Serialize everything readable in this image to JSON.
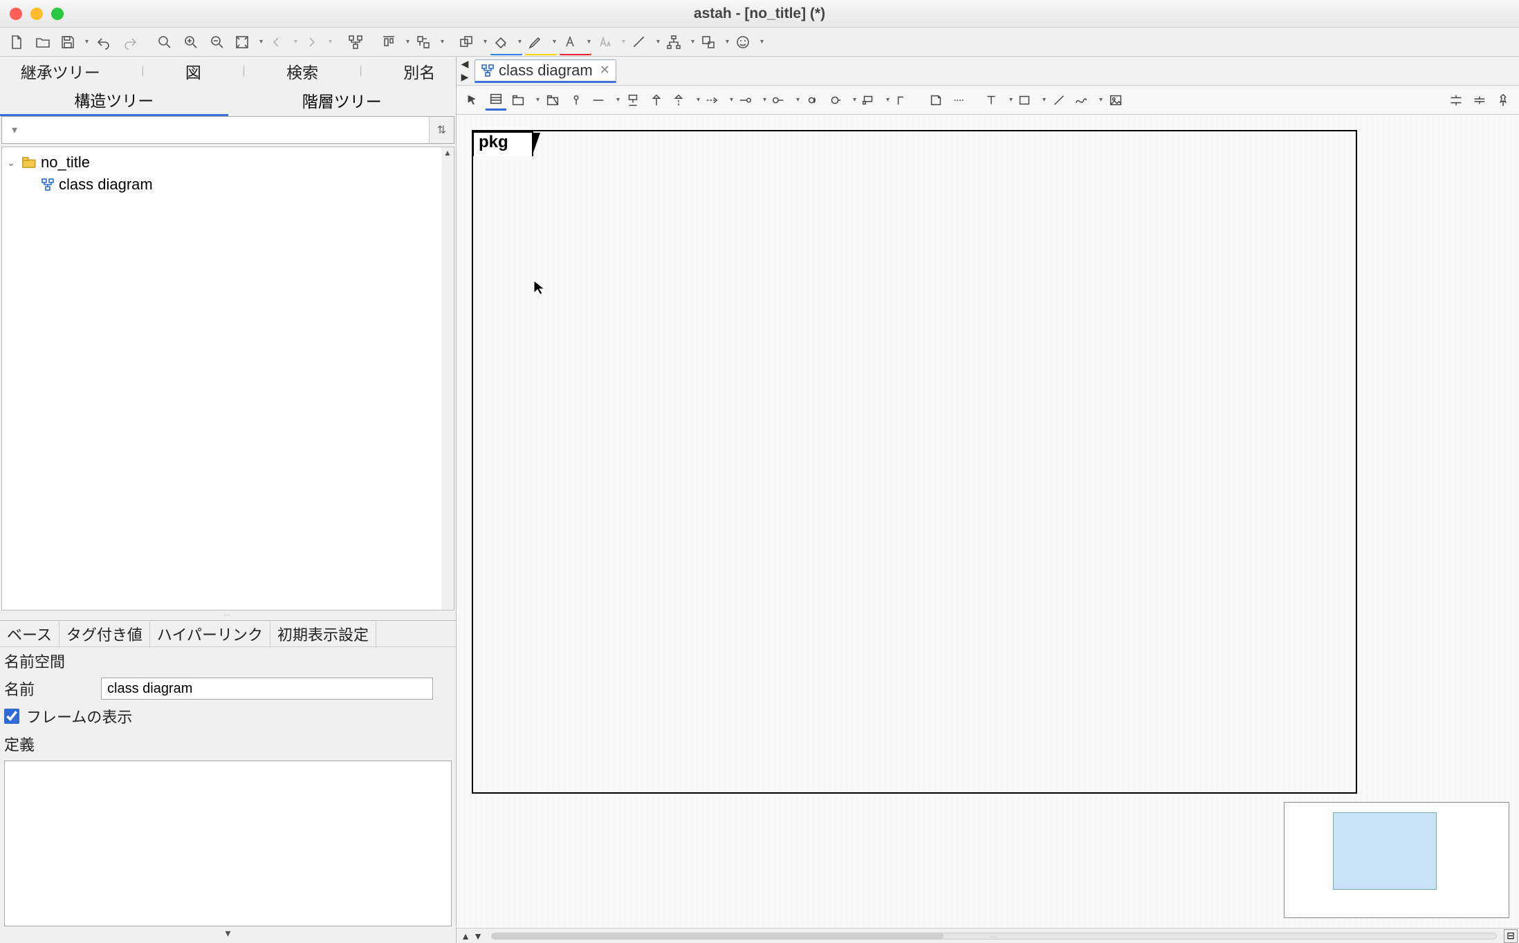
{
  "titlebar": {
    "title": "astah - [no_title] (*)"
  },
  "left": {
    "tabs_top": {
      "inherit": "継承ツリー",
      "diagram": "図",
      "search": "検索",
      "alias": "別名"
    },
    "tabs_bottom": {
      "structure": "構造ツリー",
      "hierarchy": "階層ツリー"
    },
    "filter_placeholder": "",
    "tree": {
      "root": "no_title",
      "items": [
        {
          "label": "class diagram"
        }
      ]
    }
  },
  "props": {
    "tabs": {
      "base": "ベース",
      "tagged": "タグ付き値",
      "hyperlink": "ハイパーリンク",
      "initview": "初期表示設定"
    },
    "namespace_label": "名前空間",
    "name_label": "名前",
    "name_value": "class diagram",
    "show_frame_label": "フレームの表示",
    "show_frame_checked": true,
    "definition_label": "定義"
  },
  "editor": {
    "tab_label": "class diagram",
    "frame_label": "pkg"
  },
  "icons": {
    "new": "new-file",
    "open": "open-folder",
    "save": "save",
    "undo": "undo",
    "redo": "redo",
    "zoom": "zoom",
    "zoomin": "zoom-in",
    "zoomout": "zoom-out",
    "fit": "fit",
    "back": "back",
    "forward": "forward",
    "auto": "auto-layout",
    "aligntop": "align-top",
    "sendback": "send-back",
    "fill": "fill-color",
    "highlight": "highlight",
    "textcolor": "text-color",
    "font": "font",
    "line": "line",
    "tree": "tree-style",
    "style": "style",
    "face": "face"
  }
}
